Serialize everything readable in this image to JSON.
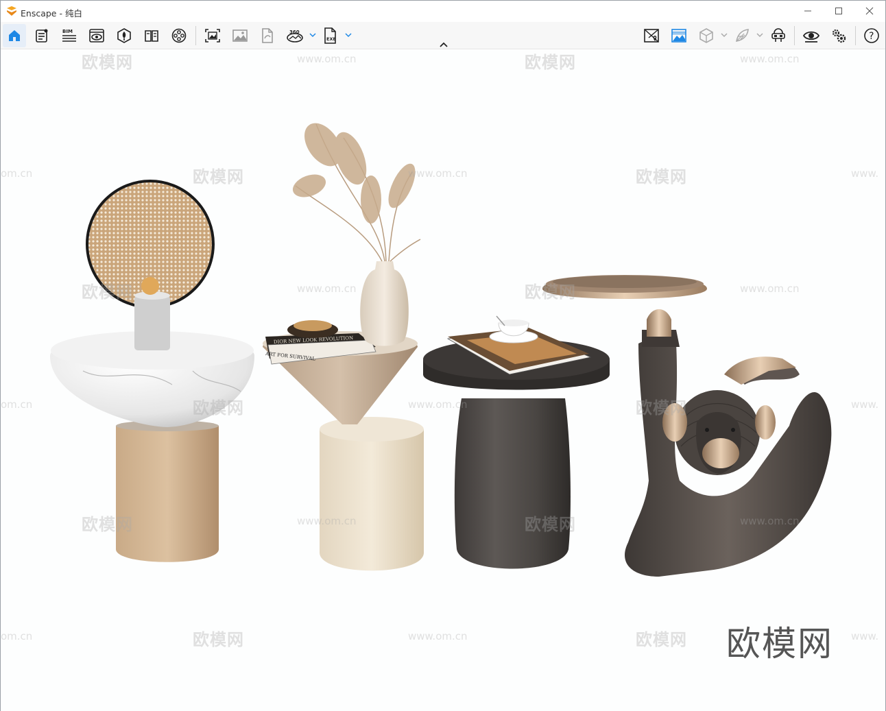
{
  "window": {
    "title": "Enscape - 纯白",
    "minimize_label": "—",
    "maximize_label": "☐",
    "close_label": "✕"
  },
  "toolbar": {
    "left_tools": [
      {
        "icon": "home-icon",
        "active": true
      },
      {
        "icon": "document-list-icon"
      },
      {
        "icon": "bim-icon",
        "label": "BIM"
      },
      {
        "icon": "view-eye-window-icon"
      },
      {
        "icon": "asset-library-icon"
      },
      {
        "icon": "book-icon"
      },
      {
        "icon": "film-reel-icon"
      },
      {
        "icon": "screenshot-icon"
      },
      {
        "icon": "image-gallery-icon"
      },
      {
        "icon": "export-file-icon"
      },
      {
        "icon": "panorama-360-icon",
        "label": "360"
      },
      {
        "icon": "exe-export-icon",
        "label": "EXE"
      }
    ],
    "right_tools": [
      {
        "icon": "map-pin-icon"
      },
      {
        "icon": "landscape-image-icon",
        "active_color": "#1e88e5"
      },
      {
        "icon": "cube-icon"
      },
      {
        "icon": "feather-icon"
      },
      {
        "icon": "vr-headset-icon"
      },
      {
        "icon": "eye-icon"
      },
      {
        "icon": "settings-gears-icon"
      },
      {
        "icon": "help-icon"
      }
    ]
  },
  "viewport": {
    "scene": "four decorative side tables rendered on white background",
    "watermark_cn": "欧模网",
    "watermark_url": "www.om.cn",
    "watermark_url_cut": "om.cn",
    "watermark_url_cut_right": "www.",
    "brand_watermark": "欧模网",
    "books": {
      "book1_title": "DIOR NEW LOOK REVOLUTION",
      "book2_title": "ART FOR SURVIVAL"
    }
  },
  "colors": {
    "accent_blue": "#1e88e5",
    "toolbar_bg": "#f7f7f7",
    "viewport_bg": "#fdfefe",
    "logo_orange": "#f5a623"
  }
}
